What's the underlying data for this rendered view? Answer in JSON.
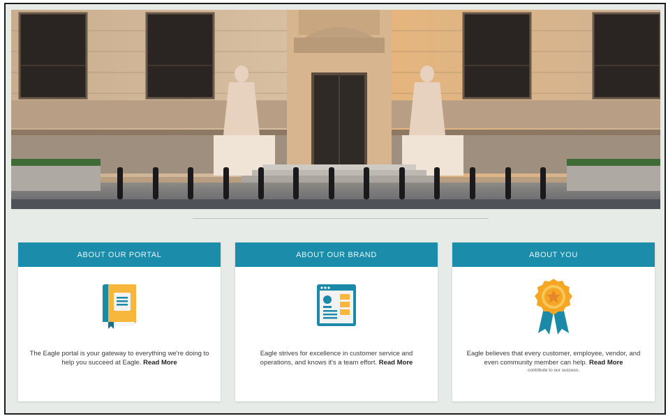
{
  "hero": {
    "image": "federal-bank-building-facade"
  },
  "cards": [
    {
      "title": "ABOUT OUR PORTAL",
      "icon": "book-icon",
      "text": "The Eagle portal is your gateway to everything we're doing to help you succeed at Eagle.",
      "link": "Read More",
      "small": ""
    },
    {
      "title": "ABOUT OUR BRAND",
      "icon": "browser-window-icon",
      "text": "Eagle strives for excellence in customer service and operations, and knows it's a team effort.",
      "link": "Read More",
      "small": ""
    },
    {
      "title": "ABOUT YOU",
      "icon": "award-ribbon-icon",
      "text": "Eagle believes that every customer, employee, vendor, and even community member can help.",
      "link": "Read More",
      "small": "contribute to our success."
    }
  ],
  "colors": {
    "header": "#1b8ca9",
    "background": "#e6ebe8",
    "icon_orange": "#f6a623",
    "icon_teal": "#1a8aa8"
  }
}
